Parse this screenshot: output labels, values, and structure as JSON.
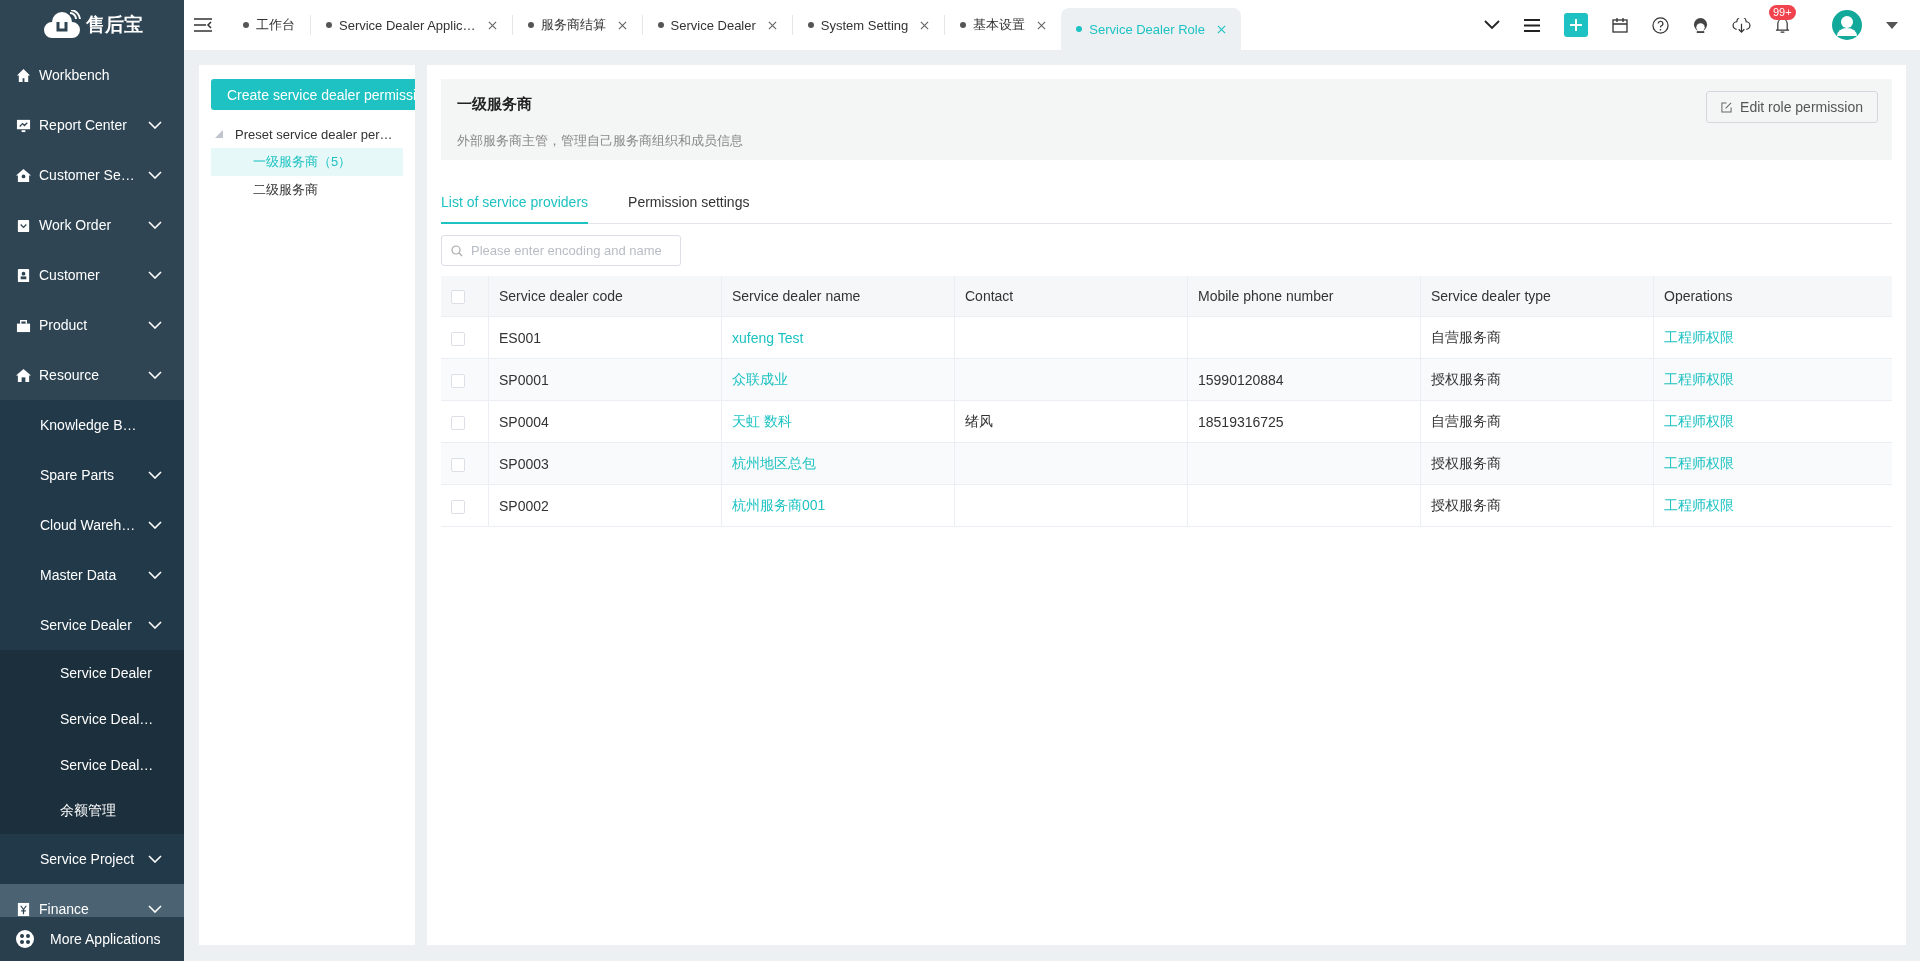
{
  "sidebar": {
    "logo_text": "售后宝",
    "items": [
      {
        "label": "Workbench",
        "expandable": false,
        "selected": false
      },
      {
        "label": "Report Center",
        "expandable": true,
        "selected": false
      },
      {
        "label": "Customer Se…",
        "expandable": true,
        "selected": false
      },
      {
        "label": "Work Order",
        "expandable": true,
        "selected": false
      },
      {
        "label": "Customer",
        "expandable": true,
        "selected": false
      },
      {
        "label": "Product",
        "expandable": true,
        "selected": false
      },
      {
        "label": "Resource",
        "expandable": true,
        "selected": false,
        "children": [
          {
            "label": "Knowledge B…",
            "expandable": false,
            "selected": false
          },
          {
            "label": "Spare Parts",
            "expandable": true,
            "selected": false
          },
          {
            "label": "Cloud Wareh…",
            "expandable": true,
            "selected": false
          },
          {
            "label": "Master Data",
            "expandable": true,
            "selected": false
          },
          {
            "label": "Service Dealer",
            "expandable": true,
            "selected": false,
            "children": [
              {
                "label": "Service Dealer",
                "expandable": false,
                "selected": false
              },
              {
                "label": "Service Deal…",
                "expandable": false,
                "selected": false
              },
              {
                "label": "Service Deal…",
                "expandable": false,
                "selected": false
              },
              {
                "label": "余额管理",
                "expandable": false,
                "selected": false
              }
            ]
          },
          {
            "label": "Service Project",
            "expandable": true,
            "selected": false
          }
        ]
      },
      {
        "label": "Finance",
        "expandable": true,
        "selected": true
      }
    ],
    "more_applications": "More Applications"
  },
  "tabs": [
    {
      "label": "工作台",
      "selected": false,
      "closable": false
    },
    {
      "label": "Service Dealer Applic…",
      "selected": false,
      "closable": true
    },
    {
      "label": "服务商结算",
      "selected": false,
      "closable": true
    },
    {
      "label": "Service Dealer",
      "selected": false,
      "closable": true
    },
    {
      "label": "System Setting",
      "selected": false,
      "closable": true
    },
    {
      "label": "基本设置",
      "selected": false,
      "closable": true
    },
    {
      "label": "Service Dealer Role",
      "selected": true,
      "closable": true
    }
  ],
  "notifications": {
    "badge": "99+"
  },
  "tree": {
    "create_button": "Create service dealer permissi",
    "nodes": [
      {
        "label": "Preset service dealer per…",
        "selected": false,
        "children": [
          {
            "label": "一级服务商（5）",
            "selected": true
          },
          {
            "label": "二级服务商",
            "selected": false
          }
        ]
      }
    ]
  },
  "role": {
    "title": "一级服务商",
    "description": "外部服务商主管，管理自己服务商组织和成员信息",
    "edit_button": "Edit role permission"
  },
  "content_tabs": [
    {
      "label": "List of service providers",
      "selected": true
    },
    {
      "label": "Permission settings",
      "selected": false
    }
  ],
  "search": {
    "placeholder": "Please enter encoding and name"
  },
  "table": {
    "header_checked": false,
    "columns": [
      "Service dealer code",
      "Service dealer name",
      "Contact",
      "Mobile phone number",
      "Service dealer type",
      "Operations"
    ],
    "rows": [
      {
        "checked": false,
        "cells": [
          "ES001",
          "xufeng Test",
          "",
          "",
          "自营服务商",
          "工程师权限"
        ]
      },
      {
        "checked": false,
        "cells": [
          "SP0001",
          "众联成业",
          "",
          "15990120884",
          "授权服务商",
          "工程师权限"
        ]
      },
      {
        "checked": false,
        "cells": [
          "SP0004",
          "天虹 数科",
          "绪风",
          "18519316725",
          "自营服务商",
          "工程师权限"
        ]
      },
      {
        "checked": false,
        "cells": [
          "SP0003",
          "杭州地区总包",
          "",
          "",
          "授权服务商",
          "工程师权限"
        ]
      },
      {
        "checked": false,
        "cells": [
          "SP0002",
          "杭州服务商001",
          "",
          "",
          "授权服务商",
          "工程师权限"
        ]
      }
    ]
  }
}
